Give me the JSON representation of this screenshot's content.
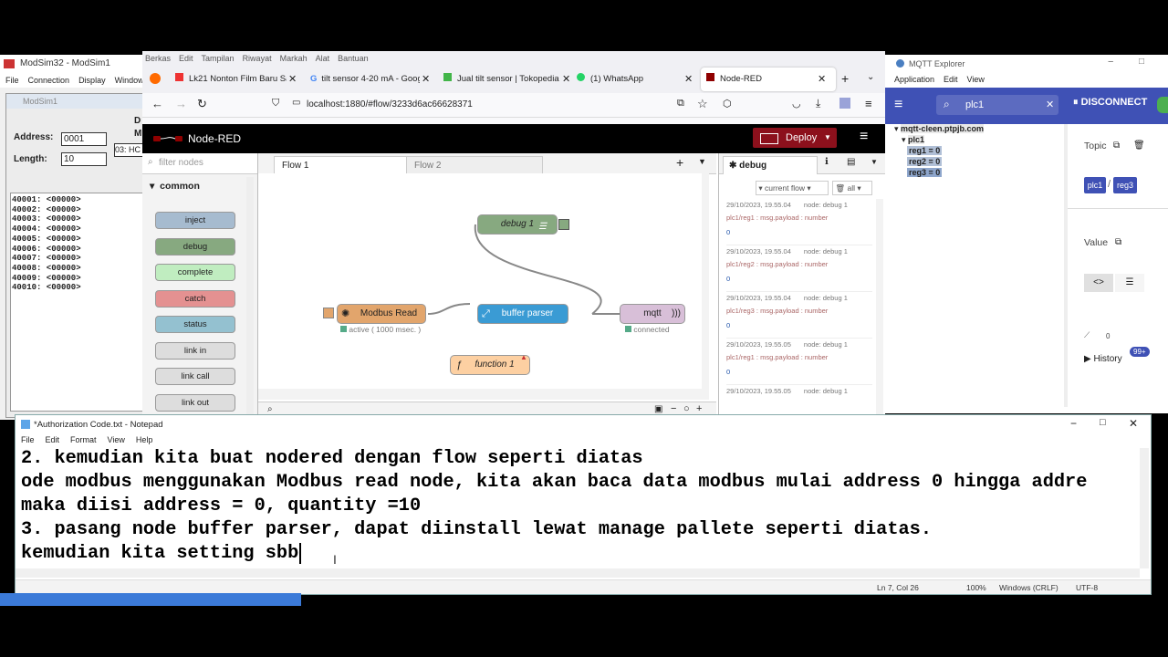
{
  "modsim": {
    "title": "ModSim32 - ModSim1",
    "menu": [
      "File",
      "Connection",
      "Display",
      "Window"
    ],
    "child_title": "ModSim1",
    "address_label": "Address:",
    "address_value": "0001",
    "length_label": "Length:",
    "length_value": "10",
    "device_label": "03: HC",
    "d_label": "D",
    "m_label": "M",
    "registers": [
      "40001: <00000>",
      "40002: <00000>",
      "40003: <00000>",
      "40004: <00000>",
      "40005: <00000>",
      "40006: <00000>",
      "40007: <00000>",
      "40008: <00000>",
      "40009: <00000>",
      "40010: <00000>"
    ]
  },
  "browser": {
    "menu": [
      "Berkas",
      "Edit",
      "Tampilan",
      "Riwayat",
      "Markah",
      "Alat",
      "Bantuan"
    ],
    "tabs": [
      "Lk21 Nonton Film Baru Saja",
      "tilt sensor 4-20 mA - Google",
      "Jual tilt sensor | Tokopedia",
      "(1) WhatsApp",
      "Node-RED"
    ],
    "url": "localhost:1880/#flow/3233d6ac66628371"
  },
  "nodered": {
    "title": "Node-RED",
    "deploy_label": "Deploy",
    "filter_placeholder": "filter nodes",
    "palette_category": "common",
    "palette_nodes": [
      {
        "label": "inject",
        "color": "#a6bbcf"
      },
      {
        "label": "debug",
        "color": "#87a980"
      },
      {
        "label": "complete",
        "color": "#c0edc0"
      },
      {
        "label": "catch",
        "color": "#e49191"
      },
      {
        "label": "status",
        "color": "#94c1d0"
      },
      {
        "label": "link in",
        "color": "#dddddd"
      },
      {
        "label": "link call",
        "color": "#dddddd"
      },
      {
        "label": "link out",
        "color": "#dddddd"
      }
    ],
    "flow_tabs": [
      "Flow 1",
      "Flow 2"
    ],
    "nodes": {
      "debug": "debug 1",
      "modbus": "Modbus Read",
      "modbus_status": "active ( 1000 msec. )",
      "parser": "buffer parser",
      "mqtt": "mqtt",
      "mqtt_status": "connected",
      "function": "function 1"
    },
    "sidebar_tab": "debug",
    "filter_flow": "current flow",
    "filter_all": "all",
    "debug_messages": [
      {
        "time": "29/10/2023, 19.55.04",
        "node": "node: debug 1",
        "topic": "plc1/reg1 : msg.payload : number",
        "value": "0"
      },
      {
        "time": "29/10/2023, 19.55.04",
        "node": "node: debug 1",
        "topic": "plc1/reg2 : msg.payload : number",
        "value": "0"
      },
      {
        "time": "29/10/2023, 19.55.04",
        "node": "node: debug 1",
        "topic": "plc1/reg3 : msg.payload : number",
        "value": "0"
      },
      {
        "time": "29/10/2023, 19.55.05",
        "node": "node: debug 1",
        "topic": "plc1/reg1 : msg.payload : number",
        "value": "0"
      },
      {
        "time": "29/10/2023, 19.55.05",
        "node": "node: debug 1",
        "topic": "",
        "value": ""
      }
    ]
  },
  "mqtt": {
    "title": "MQTT Explorer",
    "menu": [
      "Application",
      "Edit",
      "View"
    ],
    "search_value": "plc1",
    "disconnect_label": "DISCONNECT",
    "tree_root": "mqtt-cleen.ptpjb.com",
    "tree_child": "plc1",
    "tree_items": [
      "reg1 = 0",
      "reg2 = 0",
      "reg3 = 0"
    ],
    "topic_label": "Topic",
    "topic_parts": [
      "plc1",
      "reg3"
    ],
    "value_label": "Value",
    "value_zero": "0",
    "history_label": "History",
    "history_badge": "99+"
  },
  "notepad": {
    "title": "*Authorization Code.txt - Notepad",
    "menu": [
      "File",
      "Edit",
      "Format",
      "View",
      "Help"
    ],
    "lines": [
      "2. kemudian kita buat nodered dengan flow seperti diatas",
      "ode modbus menggunakan Modbus read node, kita akan baca data modbus mulai address 0 hingga addre",
      "maka diisi address = 0, quantity =10",
      "3. pasang node buffer parser, dapat diinstall lewat manage pallete seperti diatas.",
      "kemudian kita setting sbb"
    ],
    "status_pos": "Ln 7, Col 26",
    "status_zoom": "100%",
    "status_eol": "Windows (CRLF)",
    "status_enc": "UTF-8"
  }
}
